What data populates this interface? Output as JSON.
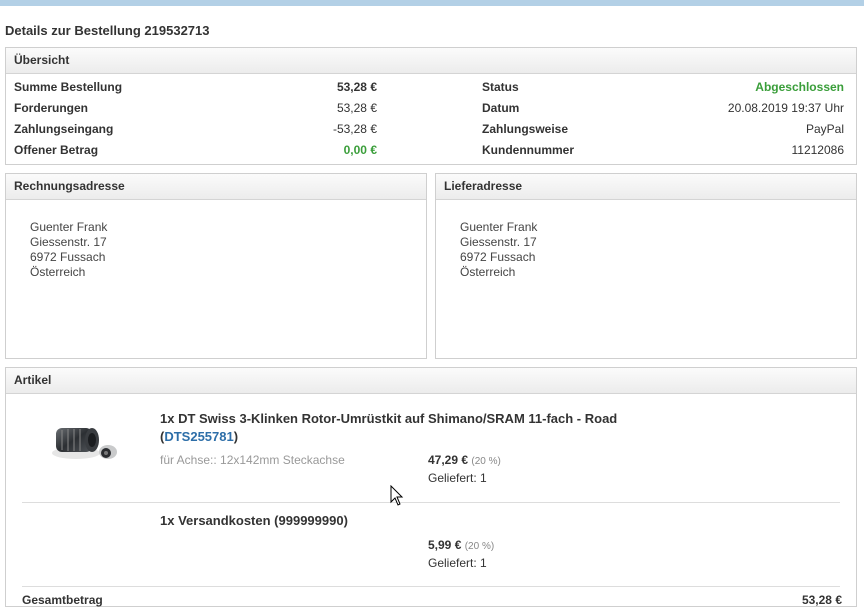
{
  "page": {
    "title": "Details zur Bestellung 219532713"
  },
  "overview": {
    "header": "Übersicht",
    "left": [
      {
        "label": "Summe Bestellung",
        "value": "53,28 €",
        "bold": true
      },
      {
        "label": "Forderungen",
        "value": "53,28 €"
      },
      {
        "label": "Zahlungseingang",
        "value": "-53,28 €"
      },
      {
        "label": "Offener Betrag",
        "value": "0,00 €",
        "green": true
      }
    ],
    "right": [
      {
        "label": "Status",
        "value": "Abgeschlossen",
        "green": true
      },
      {
        "label": "Datum",
        "value": "20.08.2019 19:37 Uhr"
      },
      {
        "label": "Zahlungsweise",
        "value": "PayPal"
      },
      {
        "label": "Kundennummer",
        "value": "11212086"
      }
    ]
  },
  "billing": {
    "header": "Rechnungsadresse",
    "lines": [
      "Guenter Frank",
      "Giessenstr. 17",
      "6972 Fussach",
      "Österreich"
    ]
  },
  "shipping": {
    "header": "Lieferadresse",
    "lines": [
      "Guenter Frank",
      "Giessenstr. 17",
      "6972 Fussach",
      "Österreich"
    ]
  },
  "articles": {
    "header": "Artikel",
    "items": [
      {
        "title": "1x DT Swiss 3-Klinken Rotor-Umrüstkit auf Shimano/SRAM 11-fach - Road",
        "sku_open": "(",
        "sku": "DTS255781",
        "sku_close": ")",
        "option": "für Achse:: 12x142mm Steckachse",
        "price": "47,29 €",
        "tax": "(20 %)",
        "delivered": "Geliefert: 1",
        "image": "hub-freehub-body-photo"
      },
      {
        "title": "1x Versandkosten (999999990)",
        "price": "5,99 €",
        "tax": "(20 %)",
        "delivered": "Geliefert: 1"
      }
    ],
    "footer_label": "Gesamtbetrag",
    "footer_value": "53,28 €"
  },
  "cursor": {
    "icon": "mouse-pointer-icon"
  }
}
